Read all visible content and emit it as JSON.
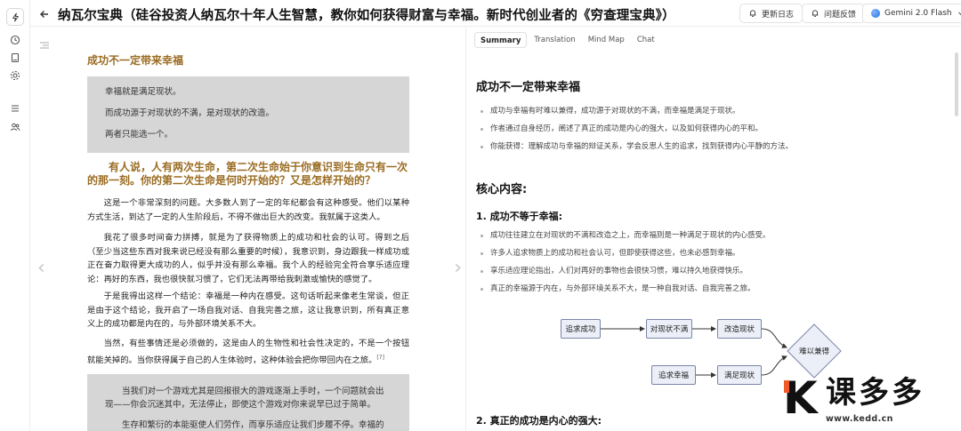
{
  "header": {
    "title": "纳瓦尔宝典（硅谷投资人纳瓦尔十年人生智慧，教你如何获得财富与幸福。新时代创业者的《穷查理宝典》）",
    "update_log": "更新日志",
    "feedback": "问题反馈",
    "model": "Gemini 2.0 Flash"
  },
  "document": {
    "heading1": "成功不一定带来幸福",
    "quote1": [
      "幸福就是满足现状。",
      "而成功源于对现状的不满，是对现状的改造。",
      "两者只能选一个。"
    ],
    "heading2": "有人说，人有两次生命，第二次生命始于你意识到生命只有一次的那一刻。你的第二次生命是何时开始的？又是怎样开始的？",
    "paragraphs": [
      "这是一个非常深刻的问题。大多数人到了一定的年纪都会有这种感受。他们以某种方式生活，到达了一定的人生阶段后，不得不做出巨大的改变。我就属于这类人。",
      "我花了很多时间奋力拼搏，就是为了获得物质上的成功和社会的认可。得到之后（至少当这些东西对我来说已经没有那么重要的时候），我意识到，身边跟我一样成功或正在奋力取得更大成功的人，似乎并没有那么幸福。我个人的经验完全符合享乐适应理论：再好的东西，我也很快就习惯了，它们无法再带给我刺激或愉快的感觉了。",
      "于是我得出这样一个结论：幸福是一种内在感受。这句话听起来像老生常谈，但正是由于这个结论，我开启了一场自我对话、自我完善之旅，这让我意识到，所有真正意义上的成功都是内在的，与外部环境关系不大。",
      "当然，有些事情还是必须做的，这是由人的生物性和社会性决定的，不是一个按钮就能关掉的。当你获得属于自己的人生体验时，这种体验会把你带回内在之旅。"
    ],
    "footnote": "[7]",
    "quote2": [
      "当我们对一个游戏尤其是回报很大的游戏逐渐上手时，一个问题就会出现——你会沉迷其中，无法停止，即使这个游戏对你来说早已过于简单。",
      "生存和繁衍的本能驱使人们劳作，而享乐适应让我们步履不停。幸福的秘诀在于，知"
    ]
  },
  "summary": {
    "tabs": [
      "Summary",
      "Translation",
      "Mind Map",
      "Chat"
    ],
    "active_tab": "Summary",
    "title": "成功不一定带来幸福",
    "intro_bullets": [
      "成功与幸福有时难以兼得，成功源于对现状的不满，而幸福是满足于现状。",
      "作者通过自身经历，阐述了真正的成功是内心的强大，以及如何获得内心的平和。",
      "你能获得：理解成功与幸福的辩证关系，学会反思人生的追求，找到获得内心平静的方法。"
    ],
    "core_heading": "核心内容:",
    "section1_title": "1. 成功不等于幸福:",
    "section1_bullets": [
      "成功往往建立在对现状的不满和改造之上，而幸福则是一种满足于现状的内心感受。",
      "许多人追求物质上的成功和社会认可，但即使获得这些，也未必感到幸福。",
      "享乐适应理论指出，人们对再好的事物也会很快习惯，难以持久地获得快乐。",
      "真正的幸福源于内在，与外部环境关系不大，是一种自我对话、自我完善之旅。"
    ],
    "diagram": {
      "nodes": {
        "pursue_success": "追求成功",
        "discontent": "对现状不满",
        "change": "改造现状",
        "pursue_happiness": "追求幸福",
        "content": "满足现状",
        "hard_both": "难以兼得"
      }
    },
    "section2_title": "2. 真正的成功是内心的强大:"
  },
  "watermark": {
    "brand": "课多多",
    "url": "www.kedd.cn"
  },
  "colors": {
    "accent_gold": "#9a6c22",
    "quote_bg": "#d6d6d6",
    "node_fill": "#eceff8",
    "node_border": "#7a86a8",
    "logo_orange": "#f05a28"
  }
}
